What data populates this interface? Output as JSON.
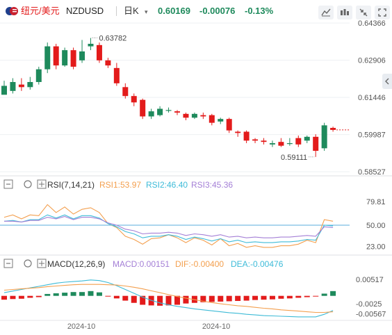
{
  "header": {
    "pair_cn": "纽元/美元",
    "symbol": "NZDUSD",
    "interval": "日K",
    "price": "0.60169",
    "change": "-0.00076",
    "change_pct": "-0.13%"
  },
  "toolbar": {
    "buttons": [
      "settings-lines-icon",
      "brush-icon",
      "indicator-icon",
      "compress-icon",
      "fullscreen-icon"
    ],
    "expand_right": "expand-arrow-icon"
  },
  "colors": {
    "up": "#1e8a5c",
    "down": "#e31b1b",
    "price_positive": "#1e8a5c",
    "rsi1": "#f39f4e",
    "rsi2": "#3dbbd8",
    "rsi3": "#a47fd6",
    "macd_line": "#3cbad6",
    "dea_line": "#f39f4e",
    "macd_hist_up": "#1e8a5c",
    "macd_hist_down": "#e31b1b",
    "price_last_line": "#e31b1b"
  },
  "chart_data": [
    {
      "type": "candlestick",
      "title": "NZDUSD 日K",
      "y_ticks": [
        "0.64366",
        "0.62906",
        "0.61446",
        "0.59987",
        "0.58527"
      ],
      "ylim": [
        0.5845,
        0.6445
      ],
      "annotations": {
        "high": "0.63782",
        "low": "0.59111"
      },
      "candles": [
        [
          0.6155,
          0.619,
          0.6168,
          0.621
        ],
        [
          0.617,
          0.6205,
          0.616,
          0.622
        ],
        [
          0.6195,
          0.6185,
          0.617,
          0.622
        ],
        [
          0.6185,
          0.6205,
          0.6175,
          0.6225
        ],
        [
          0.6205,
          0.6255,
          0.6195,
          0.6265
        ],
        [
          0.6255,
          0.6345,
          0.624,
          0.636
        ],
        [
          0.6345,
          0.627,
          0.6255,
          0.6355
        ],
        [
          0.627,
          0.633,
          0.6265,
          0.634
        ],
        [
          0.633,
          0.6265,
          0.6255,
          0.634
        ],
        [
          0.629,
          0.6325,
          0.628,
          0.637
        ],
        [
          0.6345,
          0.6355,
          0.633,
          0.6378
        ],
        [
          0.635,
          0.629,
          0.628,
          0.636
        ],
        [
          0.629,
          0.627,
          0.626,
          0.63
        ],
        [
          0.626,
          0.62,
          0.619,
          0.628
        ],
        [
          0.6185,
          0.615,
          0.614,
          0.62
        ],
        [
          0.615,
          0.6125,
          0.611,
          0.616
        ],
        [
          0.6135,
          0.607,
          0.606,
          0.614
        ],
        [
          0.607,
          0.609,
          0.606,
          0.61
        ],
        [
          0.6075,
          0.61,
          0.607,
          0.611
        ],
        [
          0.6095,
          0.6095,
          0.6085,
          0.6105
        ],
        [
          0.609,
          0.6085,
          0.6075,
          0.6095
        ],
        [
          0.608,
          0.6065,
          0.6055,
          0.6085
        ],
        [
          0.6065,
          0.608,
          0.606,
          0.6085
        ],
        [
          0.6075,
          0.607,
          0.606,
          0.6085
        ],
        [
          0.6075,
          0.6045,
          0.6035,
          0.608
        ],
        [
          0.605,
          0.606,
          0.604,
          0.6065
        ],
        [
          0.606,
          0.6015,
          0.6005,
          0.6065
        ],
        [
          0.601,
          0.6005,
          0.599,
          0.6015
        ],
        [
          0.601,
          0.5975,
          0.5965,
          0.6015
        ],
        [
          0.598,
          0.5975,
          0.5965,
          0.5985
        ],
        [
          0.5975,
          0.597,
          0.596,
          0.5985
        ],
        [
          0.596,
          0.5965,
          0.595,
          0.5975
        ],
        [
          0.597,
          0.5955,
          0.595,
          0.5985
        ],
        [
          0.5965,
          0.5965,
          0.5955,
          0.5985
        ],
        [
          0.5985,
          0.596,
          0.595,
          0.5995
        ],
        [
          0.5975,
          0.599,
          0.5965,
          0.5995
        ],
        [
          0.599,
          0.5935,
          0.5911,
          0.6
        ],
        [
          0.5945,
          0.6035,
          0.5935,
          0.6045
        ],
        [
          0.6025,
          0.6017,
          0.601,
          0.603
        ]
      ]
    },
    {
      "type": "line",
      "title": "RSI(7,14,21)",
      "labels": {
        "name": "RSI(7,14,21)",
        "rsi1": "RSI1:53.97",
        "rsi2": "RSI2:46.40",
        "rsi3": "RSI3:45.36"
      },
      "y_ticks": [
        "79.81",
        "50.00",
        "23.00"
      ],
      "ylim": [
        14,
        93
      ],
      "series": [
        {
          "name": "RSI1",
          "values": [
            60,
            63,
            58,
            63,
            62,
            76,
            66,
            73,
            64,
            70,
            72,
            66,
            52,
            47,
            36,
            32,
            26,
            33,
            34,
            38,
            34,
            28,
            34,
            31,
            25,
            33,
            24,
            27,
            22,
            24,
            22,
            22,
            24,
            24,
            26,
            31,
            28,
            57,
            55
          ]
        },
        {
          "name": "RSI2",
          "values": [
            55,
            56,
            54,
            57,
            57,
            63,
            59,
            63,
            58,
            62,
            62,
            59,
            52,
            48,
            42,
            39,
            34,
            36,
            36,
            38,
            36,
            32,
            35,
            33,
            30,
            33,
            29,
            31,
            28,
            29,
            28,
            28,
            29,
            29,
            30,
            32,
            31,
            50,
            49
          ]
        },
        {
          "name": "RSI3",
          "values": [
            55,
            55,
            54,
            56,
            56,
            60,
            58,
            61,
            57,
            60,
            60,
            58,
            53,
            50,
            45,
            43,
            39,
            40,
            40,
            41,
            40,
            37,
            39,
            38,
            36,
            38,
            35,
            36,
            34,
            35,
            34,
            34,
            35,
            35,
            36,
            37,
            36,
            48,
            47
          ]
        }
      ]
    },
    {
      "type": "bar",
      "title": "MACD(12,26,9)",
      "labels": {
        "name": "MACD(12,26,9)",
        "macd": "MACD:0.00151",
        "dif": "DIF:-0.00400",
        "dea": "DEA:-0.00476"
      },
      "y_ticks": [
        "0.00517",
        "-0.0025",
        "-0.00567"
      ],
      "ylim": [
        -0.0075,
        0.0078
      ],
      "x_labels": [
        "2024-10",
        "2024-10"
      ],
      "macd_hist": [
        -0.0012,
        -0.001,
        -0.0009,
        -0.0006,
        -0.0004,
        0.0006,
        0.0008,
        0.001,
        0.0012,
        0.0012,
        0.0015,
        0.0011,
        -0.0001,
        -0.0008,
        -0.0015,
        -0.0022,
        -0.0028,
        -0.003,
        -0.0031,
        -0.003,
        -0.0028,
        -0.0024,
        -0.0022,
        -0.002,
        -0.0019,
        -0.0018,
        -0.0017,
        -0.0016,
        -0.0015,
        -0.0013,
        -0.0012,
        -0.0011,
        -0.0009,
        -0.0008,
        -0.0006,
        -0.0004,
        -0.0002,
        0.0007,
        0.0015
      ],
      "dif": [
        0.001,
        0.0015,
        0.002,
        0.0025,
        0.003,
        0.0035,
        0.004,
        0.0043,
        0.0045,
        0.0047,
        0.005,
        0.0048,
        0.0042,
        0.0032,
        0.002,
        0.0008,
        -0.0004,
        -0.0014,
        -0.0022,
        -0.0028,
        -0.0033,
        -0.0037,
        -0.0041,
        -0.0044,
        -0.0047,
        -0.005,
        -0.0053,
        -0.0055,
        -0.0058,
        -0.006,
        -0.0062,
        -0.0063,
        -0.0064,
        -0.0065,
        -0.0066,
        -0.0066,
        -0.0066,
        -0.0058,
        -0.0046
      ],
      "dea": [
        0.0018,
        0.002,
        0.0022,
        0.0024,
        0.0026,
        0.0029,
        0.0031,
        0.0033,
        0.0035,
        0.0036,
        0.0036,
        0.0036,
        0.0035,
        0.0034,
        0.0031,
        0.0027,
        0.0022,
        0.0016,
        0.001,
        0.0004,
        -0.0002,
        -0.0007,
        -0.0012,
        -0.0017,
        -0.0021,
        -0.0025,
        -0.0028,
        -0.0031,
        -0.0033,
        -0.0036,
        -0.0039,
        -0.0041,
        -0.0044,
        -0.0046,
        -0.0048,
        -0.005,
        -0.0052,
        -0.0052,
        -0.005
      ]
    }
  ]
}
